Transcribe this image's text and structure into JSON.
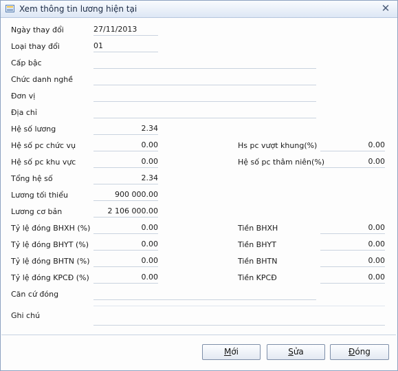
{
  "window": {
    "title": "Xem thông tin lương hiện tại"
  },
  "fields": {
    "ngay_thay_doi": {
      "label": "Ngày thay đổi",
      "value": "27/11/2013"
    },
    "loai_thay_doi": {
      "label": "Loại thay đổi",
      "value": "01"
    },
    "cap_bac": {
      "label": "Cấp bậc",
      "value": ""
    },
    "chuc_danh_nghe": {
      "label": "Chức danh nghề",
      "value": ""
    },
    "don_vi": {
      "label": "Đơn vị",
      "value": ""
    },
    "dia_chi": {
      "label": "Địa chỉ",
      "value": ""
    },
    "he_so_luong": {
      "label": "Hệ số lương",
      "value": "2.34"
    },
    "he_so_pc_chuc_vu": {
      "label": "Hệ số pc chức vụ",
      "value": "0.00"
    },
    "hs_pc_vuot_khung": {
      "label": "Hs pc vượt khung(%)",
      "value": "0.00"
    },
    "he_so_pc_khu_vuc": {
      "label": "Hệ số pc khu vực",
      "value": "0.00"
    },
    "he_so_pc_tham_nien": {
      "label": "Hệ số pc thâm niên(%)",
      "value": "0.00"
    },
    "tong_he_so": {
      "label": "Tổng hệ số",
      "value": "2.34"
    },
    "luong_toi_thieu": {
      "label": "Lương tối thiểu",
      "value": "900 000.00"
    },
    "luong_co_ban": {
      "label": "Lương cơ bản",
      "value": "2 106 000.00"
    },
    "ty_le_bhxh": {
      "label": "Tỷ lệ đóng BHXH (%)",
      "value": "0.00"
    },
    "tien_bhxh": {
      "label": "Tiền BHXH",
      "value": "0.00"
    },
    "ty_le_bhyt": {
      "label": "Tỷ lệ đóng BHYT (%)",
      "value": "0.00"
    },
    "tien_bhyt": {
      "label": "Tiền BHYT",
      "value": "0.00"
    },
    "ty_le_bhtn": {
      "label": "Tỷ lệ đóng BHTN (%)",
      "value": "0.00"
    },
    "tien_bhtn": {
      "label": "Tiền BHTN",
      "value": "0.00"
    },
    "ty_le_kpcd": {
      "label": "Tỷ lệ đóng KPCĐ (%)",
      "value": "0.00"
    },
    "tien_kpcd": {
      "label": "Tiền KPCĐ",
      "value": "0.00"
    },
    "can_cu_dong": {
      "label": "Căn cứ đóng",
      "value": ""
    },
    "ghi_chu": {
      "label": "Ghi chú",
      "value": ""
    }
  },
  "buttons": {
    "moi": {
      "label_mnemonic": "M",
      "label_rest": "ới"
    },
    "sua": {
      "label_mnemonic": "S",
      "label_rest": "ửa"
    },
    "dong": {
      "label_mnemonic": "Đ",
      "label_rest": "óng"
    }
  },
  "icons": {
    "title": "form-window-icon",
    "close": "close-icon"
  }
}
